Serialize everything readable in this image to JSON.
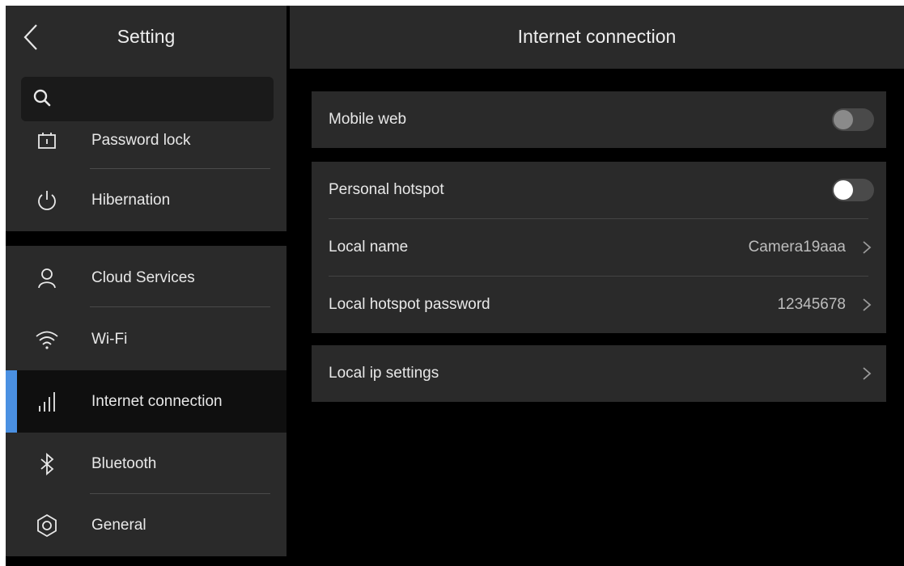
{
  "sidebar": {
    "title": "Setting",
    "search": {
      "placeholder": ""
    },
    "groups": [
      {
        "items": [
          {
            "label": "Password lock",
            "icon": "lock-icon"
          },
          {
            "label": "Hibernation",
            "icon": "power-icon"
          }
        ]
      },
      {
        "items": [
          {
            "label": "Cloud Services",
            "icon": "user-icon"
          },
          {
            "label": "Wi-Fi",
            "icon": "wifi-icon"
          },
          {
            "label": "Internet connection",
            "icon": "signal-icon",
            "active": true
          },
          {
            "label": "Bluetooth",
            "icon": "bluetooth-icon"
          },
          {
            "label": "General",
            "icon": "gear-icon"
          }
        ]
      }
    ]
  },
  "main": {
    "title": "Internet connection",
    "mobile_web": {
      "label": "Mobile web",
      "enabled": false
    },
    "hotspot": {
      "label": "Personal hotspot",
      "enabled": false,
      "local_name": {
        "label": "Local name",
        "value": "Camera19aaa"
      },
      "password": {
        "label": "Local hotspot password",
        "value": "12345678"
      }
    },
    "ip_settings": {
      "label": "Local ip settings"
    }
  },
  "colors": {
    "accent": "#4a90e2",
    "panel": "#2a2a2a",
    "background": "#000000"
  }
}
